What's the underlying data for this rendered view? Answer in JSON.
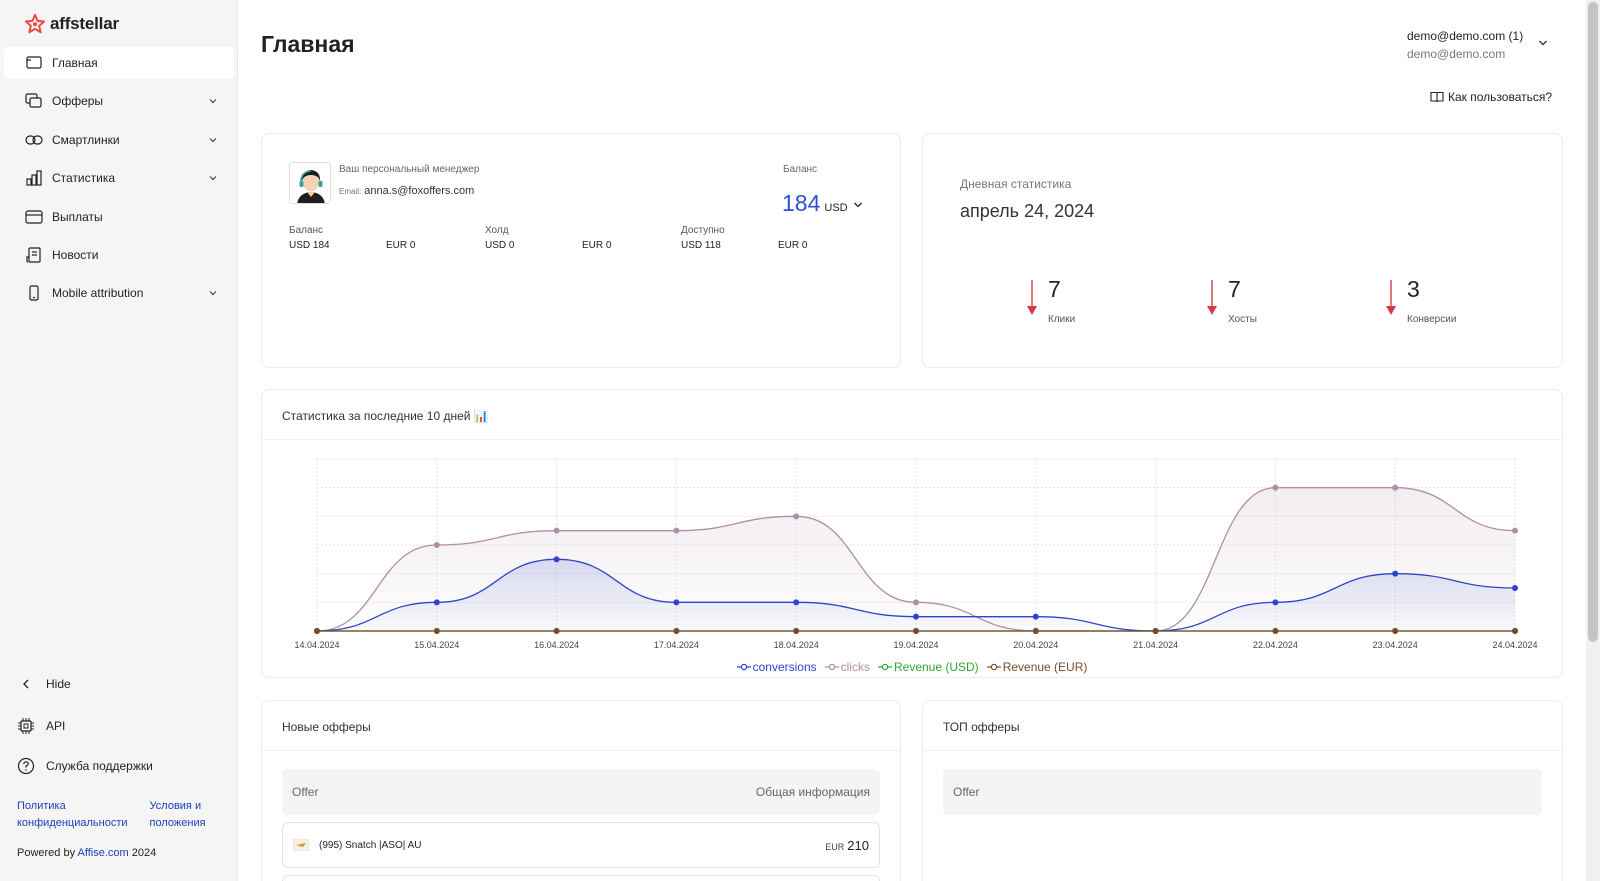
{
  "app": {
    "brand": "affstellar",
    "brand_color": "#f04a3e",
    "accent": "#2c4fd6"
  },
  "sidebar": {
    "items": [
      {
        "label": "Главная",
        "icon": "home-icon",
        "active": true,
        "has_children": false
      },
      {
        "label": "Офферы",
        "icon": "offers-icon",
        "has_children": true
      },
      {
        "label": "Смартлинки",
        "icon": "link-icon",
        "has_children": true
      },
      {
        "label": "Статистика",
        "icon": "bar-chart-icon",
        "has_children": true
      },
      {
        "label": "Выплаты",
        "icon": "card-icon",
        "has_children": false
      },
      {
        "label": "Новости",
        "icon": "news-icon",
        "has_children": false
      },
      {
        "label": "Mobile attribution",
        "icon": "mobile-icon",
        "has_children": true
      }
    ],
    "hide_label": "Hide",
    "api_label": "API",
    "support_label": "Служба поддержки",
    "privacy_line1": "Политика",
    "privacy_line2": "конфиденциальности",
    "terms_line1": "Условия и",
    "terms_line2": "положения",
    "powered_prefix": "Powered by",
    "powered_link": "Affise.com",
    "powered_year": "2024"
  },
  "header": {
    "title": "Главная",
    "user_primary": "demo@demo.com (1)",
    "user_secondary": "demo@demo.com",
    "help_label": "Как пользоваться?"
  },
  "manager_card": {
    "label": "Ваш персональный менеджер",
    "email_label": "Email:",
    "email": "anna.s@foxoffers.com",
    "balance_label": "Баланс",
    "balance_value": "184",
    "balance_currency": "USD",
    "groups": [
      {
        "label": "Баланс",
        "usd": "USD  184",
        "eur": "EUR  0"
      },
      {
        "label": "Холд",
        "usd": "USD  0",
        "eur": "EUR  0"
      },
      {
        "label": "Доступно",
        "usd": "USD  118",
        "eur": "EUR  0"
      }
    ]
  },
  "daily_card": {
    "label": "Дневная статистика",
    "date": "апрель 24, 2024",
    "stats": [
      {
        "value": "7",
        "label": "Клики",
        "trend": "down"
      },
      {
        "value": "7",
        "label": "Хосты",
        "trend": "down"
      },
      {
        "value": "3",
        "label": "Конверсии",
        "trend": "down"
      }
    ]
  },
  "chart_card": {
    "title": "Статистика за последние 10 дней 📊"
  },
  "chart_data": {
    "type": "area",
    "x": [
      "14.04.2024",
      "15.04.2024",
      "16.04.2024",
      "17.04.2024",
      "18.04.2024",
      "19.04.2024",
      "20.04.2024",
      "21.04.2024",
      "22.04.2024",
      "23.04.2024",
      "24.04.2024"
    ],
    "ylim": [
      0,
      12
    ],
    "grid": true,
    "legend": "bottom-center",
    "series": [
      {
        "name": "conversions",
        "color": "#2f44c9",
        "values": [
          0,
          2,
          5,
          2,
          2,
          1,
          1,
          0,
          2,
          4,
          3
        ]
      },
      {
        "name": "clicks",
        "color": "#b08ea4",
        "values": [
          0,
          6,
          7,
          7,
          8,
          2,
          0,
          0,
          10,
          10,
          7
        ]
      },
      {
        "name": "Revenue (USD)",
        "color": "#2fa831",
        "values": [
          0,
          0,
          0,
          0,
          0,
          0,
          0,
          0,
          0,
          0,
          0
        ]
      },
      {
        "name": "Revenue (EUR)",
        "color": "#7a4a2a",
        "values": [
          0,
          0,
          0,
          0,
          0,
          0,
          0,
          0,
          0,
          0,
          0
        ]
      }
    ]
  },
  "new_offers": {
    "title": "Новые офферы",
    "col_offer": "Offer",
    "col_info": "Общая информация",
    "rows": [
      {
        "name": "(995) Snatch |ASO| AU",
        "currency": "EUR",
        "price": "210"
      }
    ]
  },
  "top_offers": {
    "title": "ТОП офферы",
    "col_offer": "Offer"
  }
}
